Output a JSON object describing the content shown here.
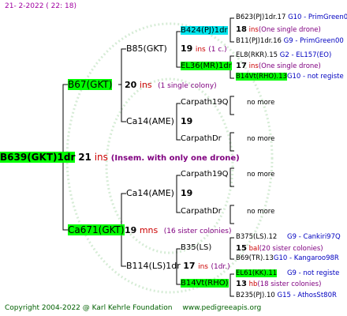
{
  "header": {
    "date": "21-  2-2022  ( 22: 18)"
  },
  "footer": {
    "copyright": "Copyright 2004-2022 @ Karl Kehrle Foundation",
    "site": "www.pedigreeapis.org"
  },
  "colors": {
    "highlight_green": "#00ff00",
    "highlight_cyan": "#00e5ee",
    "line": "#000000",
    "watermark": "#d6ecd6"
  },
  "root": {
    "name": "B639(GKT)1dr",
    "num": "21",
    "ins": "ins",
    "note": "(Insem. with only one drone)"
  },
  "gen1": [
    {
      "name": "B67(GKT)",
      "num": "20",
      "unit": "ins",
      "note": "(1 single colony)"
    },
    {
      "name": "Ca671(GKT)",
      "num": "19",
      "unit": "mns",
      "note": "(16 sister colonies)"
    }
  ],
  "gen2": [
    {
      "name": "B85(GKT)",
      "num": "19",
      "unit": "ins",
      "note": "(1 c.)"
    },
    {
      "name": "Ca14(AME)",
      "num": "19"
    },
    {
      "name": "Ca14(AME)",
      "num": "19"
    },
    {
      "name": "B114(LS)1dr",
      "num": "17",
      "unit": "ins",
      "note": "(1dr.)"
    }
  ],
  "gen3": [
    {
      "name": "B424(PJ)1dr"
    },
    {
      "name": "EL36(MR)1dr"
    },
    {
      "name": "Carpath19Q",
      "more": "no more"
    },
    {
      "name": "CarpathDr",
      "more": "no more"
    },
    {
      "name": "Carpath19Q",
      "more": "no more"
    },
    {
      "name": "CarpathDr",
      "more": "no more"
    },
    {
      "name": "B35(LS)"
    },
    {
      "name": "B14Vt(RHO)"
    }
  ],
  "gen4": [
    {
      "line1": "B623(PJ)1dr.17",
      "g1": "G10 - PrimGreen00",
      "num": "18",
      "unit": "ins",
      "note": "(One single drone)",
      "line2": "B11(PJ)1dr.16",
      "g2": "G9 - PrimGreen00"
    },
    {
      "line1": "EL8(RKR).15",
      "g1": "G2 - EL157(EO)",
      "num": "17",
      "unit": "ins",
      "note": "(One single drone)",
      "line2": "B14Vt(RHO).13",
      "g2": "G10 - not registe"
    },
    {
      "line1": "B375(LS).12",
      "g1": "G9 - Cankiri97Q",
      "num": "15",
      "unit": "bal",
      "note": "(20 sister colonies)",
      "line2": "B69(TR).13",
      "g2": "G10 - Kangaroo98R"
    },
    {
      "line1": "EL61(KK).11",
      "g1": "G9 - not registe",
      "num": "13",
      "unit": "hb",
      "note": "(18 sister colonies)",
      "line2": "B235(PJ).10",
      "g2": "G15 - AthosSt80R"
    }
  ]
}
